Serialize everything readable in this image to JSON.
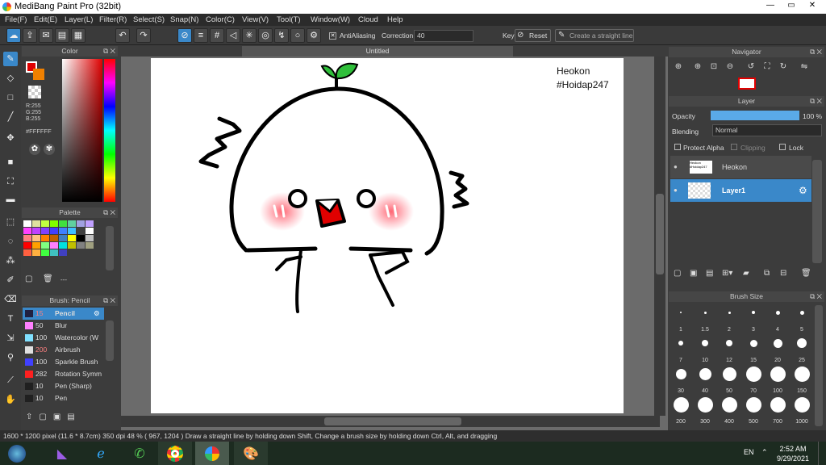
{
  "window": {
    "title": "MediBang Paint Pro (32bit)",
    "min": "—",
    "max": "▭",
    "close": "✕"
  },
  "menu": [
    "File(F)",
    "Edit(E)",
    "Layer(L)",
    "Filter(R)",
    "Select(S)",
    "Snap(N)",
    "Color(C)",
    "View(V)",
    "Tool(T)",
    "Window(W)",
    "Cloud",
    "Help"
  ],
  "toolbar": {
    "antialiasing_label": "AntiAliasing",
    "correction_label": "Correction",
    "correction_value": "40",
    "key_label": "Key",
    "reset_label": "Reset",
    "straight_line_label": "Create a straight line"
  },
  "canvas": {
    "tab_title": "Untitled",
    "watermark_line1": "Heokon",
    "watermark_line2": "#Hoidap247"
  },
  "color_panel": {
    "title": "Color",
    "r": "R:255",
    "g": "G:255",
    "b": "B:255",
    "hex": "#FFFFFF",
    "primary": "#e00000",
    "secondary": "#f08000"
  },
  "palette_panel": {
    "title": "Palette",
    "extra": "---",
    "colors": [
      "#ffffff",
      "#e0e0a0",
      "#c0ff40",
      "#80ff00",
      "#40e040",
      "#60d0a0",
      "#a0a0e0",
      "#c0a0ff",
      "#ff40ff",
      "#c040ff",
      "#8040ff",
      "#4040ff",
      "#4080ff",
      "#40c0ff",
      "#404040",
      "#ffffff",
      "#ff8080",
      "#ffc080",
      "#ff8000",
      "#c06000",
      "#4080c0",
      "#ffff00",
      "#000000",
      "#c0c0c0",
      "#ff0000",
      "#ffa000",
      "#80ff80",
      "#ff80ff",
      "#00e0e0",
      "#c0c000",
      "#808080",
      "#a0a080",
      "#ff6040",
      "#ffb040",
      "#40ff40",
      "#40c0c0",
      "#4040c0"
    ]
  },
  "brush_panel": {
    "title": "Brush: Pencil",
    "items": [
      {
        "size": "15",
        "name": "Pencil",
        "color": "#202040"
      },
      {
        "size": "50",
        "name": "Blur",
        "color": "#ff80ff"
      },
      {
        "size": "100",
        "name": "Watercolor (W",
        "color": "#80e0ff"
      },
      {
        "size": "200",
        "name": "Airbrush",
        "color": "#e0e0e0"
      },
      {
        "size": "100",
        "name": "Sparkle Brush",
        "color": "#4040ff"
      },
      {
        "size": "282",
        "name": "Rotation Symm",
        "color": "#ff2020"
      },
      {
        "size": "10",
        "name": "Pen (Sharp)",
        "color": "#202020"
      },
      {
        "size": "10",
        "name": "Pen",
        "color": "#202020"
      }
    ]
  },
  "navigator": {
    "title": "Navigator"
  },
  "layer_panel": {
    "title": "Layer",
    "opacity_label": "Opacity",
    "opacity_value": "100 %",
    "blending_label": "Blending",
    "blending_value": "Normal",
    "protect_alpha": "Protect Alpha",
    "clipping": "Clipping",
    "lock": "Lock",
    "layers": [
      {
        "name": "Heokon",
        "thumb_text": "Heokon #Hoidap247"
      },
      {
        "name": "Layer1",
        "thumb_text": ""
      }
    ]
  },
  "brush_size_panel": {
    "title": "Brush Size",
    "sizes": [
      "1",
      "1.5",
      "2",
      "3",
      "4",
      "5",
      "7",
      "10",
      "12",
      "15",
      "20",
      "25",
      "30",
      "40",
      "50",
      "70",
      "100",
      "150",
      "200",
      "300",
      "400",
      "500",
      "700",
      "1000"
    ]
  },
  "status": "1600 * 1200 pixel   (11.6 * 8.7cm)   350 dpi   48 %   ( 967, 1204 )   Draw a straight line by holding down Shift, Change a brush size by holding down Ctrl, Alt, and dragging",
  "taskbar": {
    "lang": "EN",
    "time": "2:52 AM",
    "date": "9/29/2021"
  }
}
